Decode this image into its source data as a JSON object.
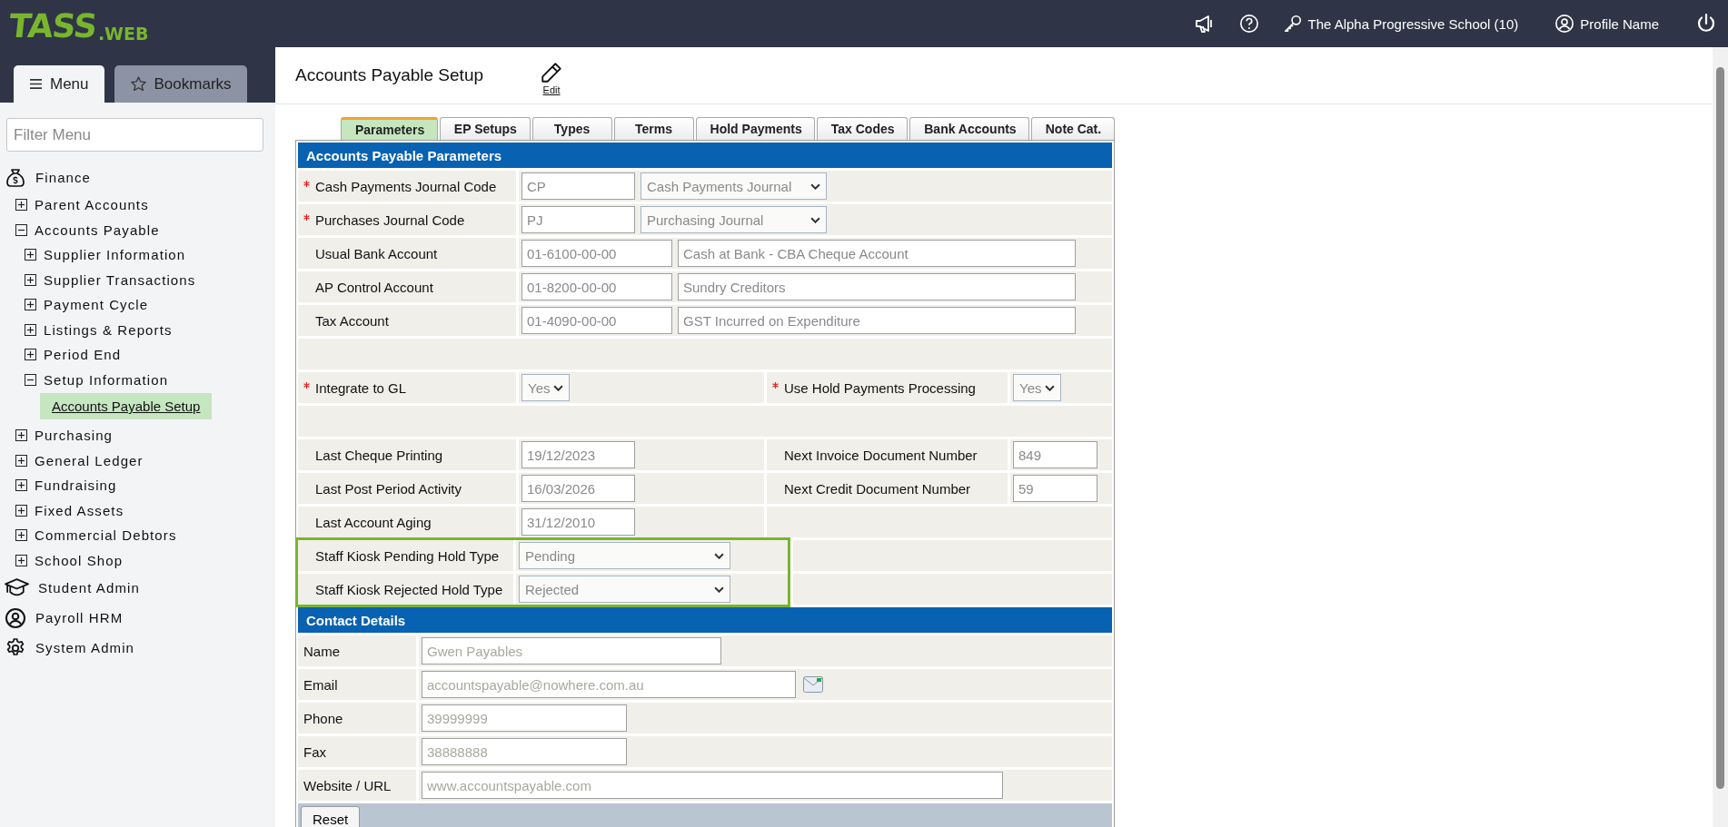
{
  "header": {
    "logo_main": "TASS",
    "logo_sub": ".WEB",
    "school": "The Alpha Progressive School (10)",
    "profile": "Profile Name"
  },
  "sidebar": {
    "tabs": [
      {
        "label": "Menu",
        "selected": true
      },
      {
        "label": "Bookmarks",
        "selected": false
      }
    ],
    "filter_placeholder": "Filter Menu",
    "modules": [
      {
        "label": "Finance",
        "children": [
          {
            "label": "Parent Accounts",
            "expanded": false
          },
          {
            "label": "Accounts Payable",
            "expanded": true,
            "children": [
              {
                "label": "Supplier Information",
                "expanded": false
              },
              {
                "label": "Supplier Transactions",
                "expanded": false
              },
              {
                "label": "Payment Cycle",
                "expanded": false
              },
              {
                "label": "Listings & Reports",
                "expanded": false
              },
              {
                "label": "Period End",
                "expanded": false
              },
              {
                "label": "Setup Information",
                "expanded": true,
                "children": [
                  {
                    "label": "Accounts Payable Setup",
                    "selected": true
                  }
                ]
              }
            ]
          },
          {
            "label": "Purchasing",
            "expanded": false
          },
          {
            "label": "General Ledger",
            "expanded": false
          },
          {
            "label": "Fundraising",
            "expanded": false
          },
          {
            "label": "Fixed Assets",
            "expanded": false
          },
          {
            "label": "Commercial Debtors",
            "expanded": false
          },
          {
            "label": "School Shop",
            "expanded": false
          }
        ]
      },
      {
        "label": "Student Admin"
      },
      {
        "label": "Payroll HRM"
      },
      {
        "label": "System Admin"
      }
    ]
  },
  "page": {
    "title": "Accounts Payable Setup",
    "edit_label": "Edit",
    "tabs": [
      {
        "label": "Parameters",
        "selected": true
      },
      {
        "label": "EP Setups",
        "selected": false
      },
      {
        "label": "Types",
        "selected": false
      },
      {
        "label": "Terms",
        "selected": false
      },
      {
        "label": "Hold Payments",
        "selected": false
      },
      {
        "label": "Tax Codes",
        "selected": false
      },
      {
        "label": "Bank Accounts",
        "selected": false
      },
      {
        "label": "Note Cat.",
        "selected": false
      }
    ],
    "parameters": {
      "title": "Accounts Payable Parameters",
      "rows": [
        {
          "kind": "fields",
          "left": {
            "label": "Cash Payments Journal Code",
            "required": true,
            "kind": "code_select",
            "value": "CP",
            "option": "Cash Payments Journal"
          }
        },
        {
          "kind": "fields",
          "left": {
            "label": "Purchases Journal Code",
            "required": true,
            "kind": "code_select",
            "value": "PJ",
            "option": "Purchasing Journal"
          }
        },
        {
          "kind": "fields",
          "left": {
            "label": "Usual Bank Account",
            "required": false,
            "kind": "code_name",
            "value": "01-6100-00-00",
            "name": "Cash at Bank - CBA Cheque Account"
          }
        },
        {
          "kind": "fields",
          "left": {
            "label": "AP Control Account",
            "required": false,
            "kind": "code_name",
            "value": "01-8200-00-00",
            "name": "Sundry Creditors"
          }
        },
        {
          "kind": "fields",
          "left": {
            "label": "Tax Account",
            "required": false,
            "kind": "code_name",
            "value": "01-4090-00-00",
            "name": "GST Incurred on Expenditure"
          }
        },
        {
          "kind": "spacer"
        },
        {
          "kind": "fields",
          "left": {
            "label": "Integrate to GL",
            "required": true,
            "kind": "small_select",
            "value": "Yes"
          },
          "right": {
            "label": "Use Hold Payments Processing",
            "required": true,
            "kind": "small_select",
            "value": "Yes"
          }
        },
        {
          "kind": "spacer"
        },
        {
          "kind": "fields",
          "left": {
            "label": "Last Cheque Printing",
            "required": false,
            "kind": "text",
            "value": "19/12/2023"
          },
          "right": {
            "label": "Next Invoice Document Number",
            "required": false,
            "kind": "text",
            "value": "849"
          }
        },
        {
          "kind": "fields",
          "left": {
            "label": "Last Post Period Activity",
            "required": false,
            "kind": "text",
            "value": "16/03/2026"
          },
          "right": {
            "label": "Next Credit Document Number",
            "required": false,
            "kind": "text",
            "value": "59"
          }
        },
        {
          "kind": "fields",
          "left": {
            "label": "Last Account Aging",
            "required": false,
            "kind": "text",
            "value": "31/12/2010"
          }
        }
      ],
      "highlighted_rows": [
        {
          "label": "Staff Kiosk Pending Hold Type",
          "required": false,
          "kind": "wide_select",
          "value": "Pending"
        },
        {
          "label": "Staff Kiosk Rejected Hold Type",
          "required": false,
          "kind": "wide_select",
          "value": "Rejected"
        }
      ]
    },
    "contact": {
      "title": "Contact Details",
      "rows": [
        {
          "label": "Name",
          "kind": "medium",
          "value": "Gwen Payables"
        },
        {
          "label": "Email",
          "kind": "email",
          "value": "accountspayable@nowhere.com.au"
        },
        {
          "label": "Phone",
          "kind": "short",
          "value": "39999999"
        },
        {
          "label": "Fax",
          "kind": "short",
          "value": "38888888"
        },
        {
          "label": "Website / URL",
          "kind": "long",
          "value": "www.accountspayable.com"
        }
      ]
    },
    "reset_label": "Reset"
  }
}
